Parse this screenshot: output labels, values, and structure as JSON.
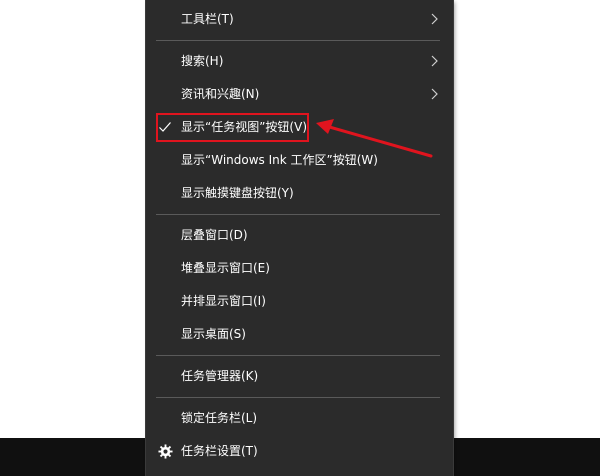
{
  "context_menu": {
    "items": [
      {
        "label": "工具栏(T)",
        "has_submenu": true
      },
      {
        "label": "搜索(H)",
        "has_submenu": true
      },
      {
        "label": "资讯和兴趣(N)",
        "has_submenu": true
      },
      {
        "label": "显示“任务视图”按钮(V)",
        "checked": true
      },
      {
        "label": "显示“Windows Ink 工作区”按钮(W)"
      },
      {
        "label": "显示触摸键盘按钮(Y)"
      },
      {
        "label": "层叠窗口(D)"
      },
      {
        "label": "堆叠显示窗口(E)"
      },
      {
        "label": "并排显示窗口(I)"
      },
      {
        "label": "显示桌面(S)"
      },
      {
        "label": "任务管理器(K)"
      },
      {
        "label": "锁定任务栏(L)"
      },
      {
        "label": "任务栏设置(T)",
        "icon": "gear-icon"
      }
    ]
  },
  "annotation": {
    "color": "#e0141e"
  },
  "colors": {
    "menu_background": "#2b2b2b",
    "taskbar_background": "#101010",
    "text": "#ffffff"
  }
}
